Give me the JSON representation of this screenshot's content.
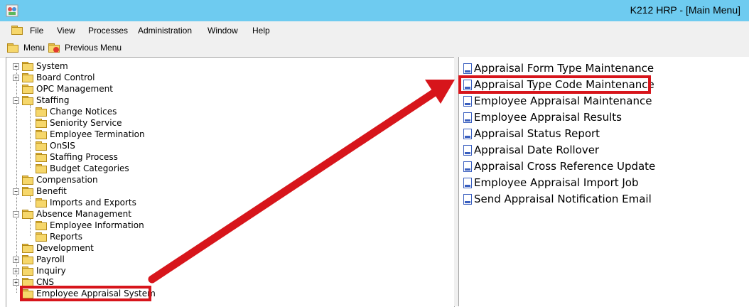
{
  "window": {
    "title": "K212 HRP - [Main Menu]"
  },
  "menubar": {
    "items": [
      "File",
      "View",
      "Processes",
      "Administration",
      "Window",
      "Help"
    ]
  },
  "toolbar": {
    "menu_label": "Menu",
    "previous_label": "Previous Menu"
  },
  "tree": {
    "nodes": [
      {
        "label": "System",
        "level": 0,
        "expander": "+"
      },
      {
        "label": "Board Control",
        "level": 0,
        "expander": "+"
      },
      {
        "label": "OPC Management",
        "level": 0,
        "expander": ""
      },
      {
        "label": "Staffing",
        "level": 0,
        "expander": "-"
      },
      {
        "label": "Change Notices",
        "level": 1,
        "expander": ""
      },
      {
        "label": "Seniority Service",
        "level": 1,
        "expander": ""
      },
      {
        "label": "Employee Termination",
        "level": 1,
        "expander": ""
      },
      {
        "label": "OnSIS",
        "level": 1,
        "expander": ""
      },
      {
        "label": "Staffing Process",
        "level": 1,
        "expander": ""
      },
      {
        "label": "Budget Categories",
        "level": 1,
        "expander": ""
      },
      {
        "label": "Compensation",
        "level": 0,
        "expander": ""
      },
      {
        "label": "Benefit",
        "level": 0,
        "expander": "-"
      },
      {
        "label": "Imports and Exports",
        "level": 1,
        "expander": ""
      },
      {
        "label": "Absence Management",
        "level": 0,
        "expander": "-"
      },
      {
        "label": "Employee Information",
        "level": 1,
        "expander": ""
      },
      {
        "label": "Reports",
        "level": 1,
        "expander": ""
      },
      {
        "label": "Development",
        "level": 0,
        "expander": ""
      },
      {
        "label": "Payroll",
        "level": 0,
        "expander": "+"
      },
      {
        "label": "Inquiry",
        "level": 0,
        "expander": "+"
      },
      {
        "label": "CNS",
        "level": 0,
        "expander": "+"
      },
      {
        "label": "Employee Appraisal System",
        "level": 0,
        "expander": ""
      }
    ]
  },
  "right_list": {
    "items": [
      "Appraisal Form Type Maintenance",
      "Appraisal Type Code Maintenance",
      "Employee Appraisal Maintenance",
      "Employee Appraisal Results",
      "Appraisal Status Report",
      "Appraisal Date Rollover",
      "Appraisal Cross Reference Update",
      "Employee Appraisal Import Job",
      "Send Appraisal Notification Email"
    ]
  },
  "colors": {
    "titlebar": "#6ecbf0",
    "highlight": "#d7151b",
    "folder": "#f6d76b"
  }
}
